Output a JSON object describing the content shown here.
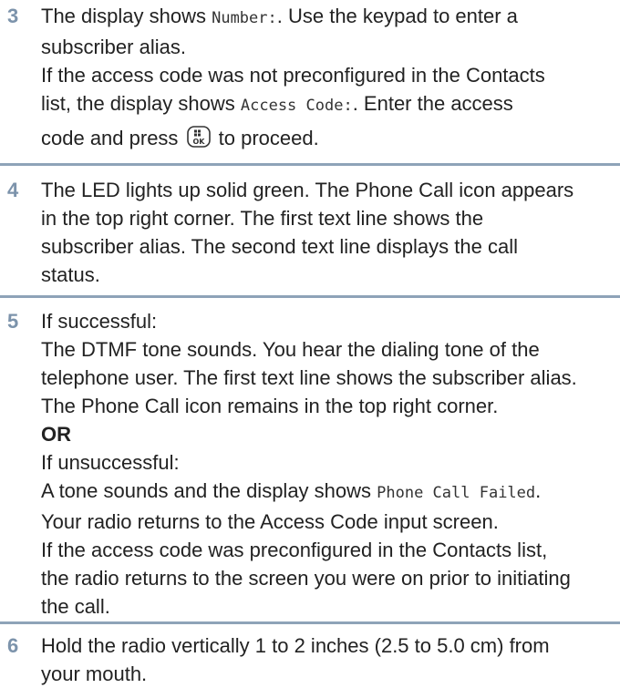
{
  "steps": [
    {
      "number": "3",
      "lines": [
        {
          "pre": "The display shows ",
          "mono": "Number:",
          "post": ". Use the keypad to enter a"
        },
        {
          "text": "subscriber alias."
        },
        {
          "text": "If the access code was not preconfigured in the Contacts"
        },
        {
          "pre": "list, the display shows ",
          "mono": "Access Code:",
          "post": ". Enter the access"
        },
        {
          "pre": "code and press ",
          "icon": "ok-menu-key-icon",
          "post": " to proceed."
        }
      ]
    },
    {
      "number": "4",
      "lines": [
        {
          "text": "The LED lights up solid green. The Phone Call icon appears"
        },
        {
          "text": "in the top right corner. The first text line shows the"
        },
        {
          "text": "subscriber alias. The second text line displays the call"
        },
        {
          "text": "status."
        }
      ]
    },
    {
      "number": "5",
      "lines": [
        {
          "text": "If successful:"
        },
        {
          "text": "The DTMF tone sounds. You hear the dialing tone of the"
        },
        {
          "text": "telephone user. The first text line shows the subscriber alias."
        },
        {
          "text": "The Phone Call icon remains in the top right corner."
        },
        {
          "bold": "OR"
        },
        {
          "text": "If unsuccessful:"
        },
        {
          "pre": "A tone sounds and the display shows ",
          "mono": "Phone Call Failed",
          "post": "."
        },
        {
          "text": "Your radio returns to the Access Code input screen."
        },
        {
          "text": "If the access code was preconfigured in the Contacts list,"
        },
        {
          "text": "the radio returns to the screen you were on prior to initiating"
        },
        {
          "text": "the call."
        }
      ]
    },
    {
      "number": "6",
      "lines": [
        {
          "text": "Hold the radio vertically 1 to 2 inches (2.5 to 5.0 cm) from"
        },
        {
          "text": "your mouth."
        }
      ]
    }
  ]
}
